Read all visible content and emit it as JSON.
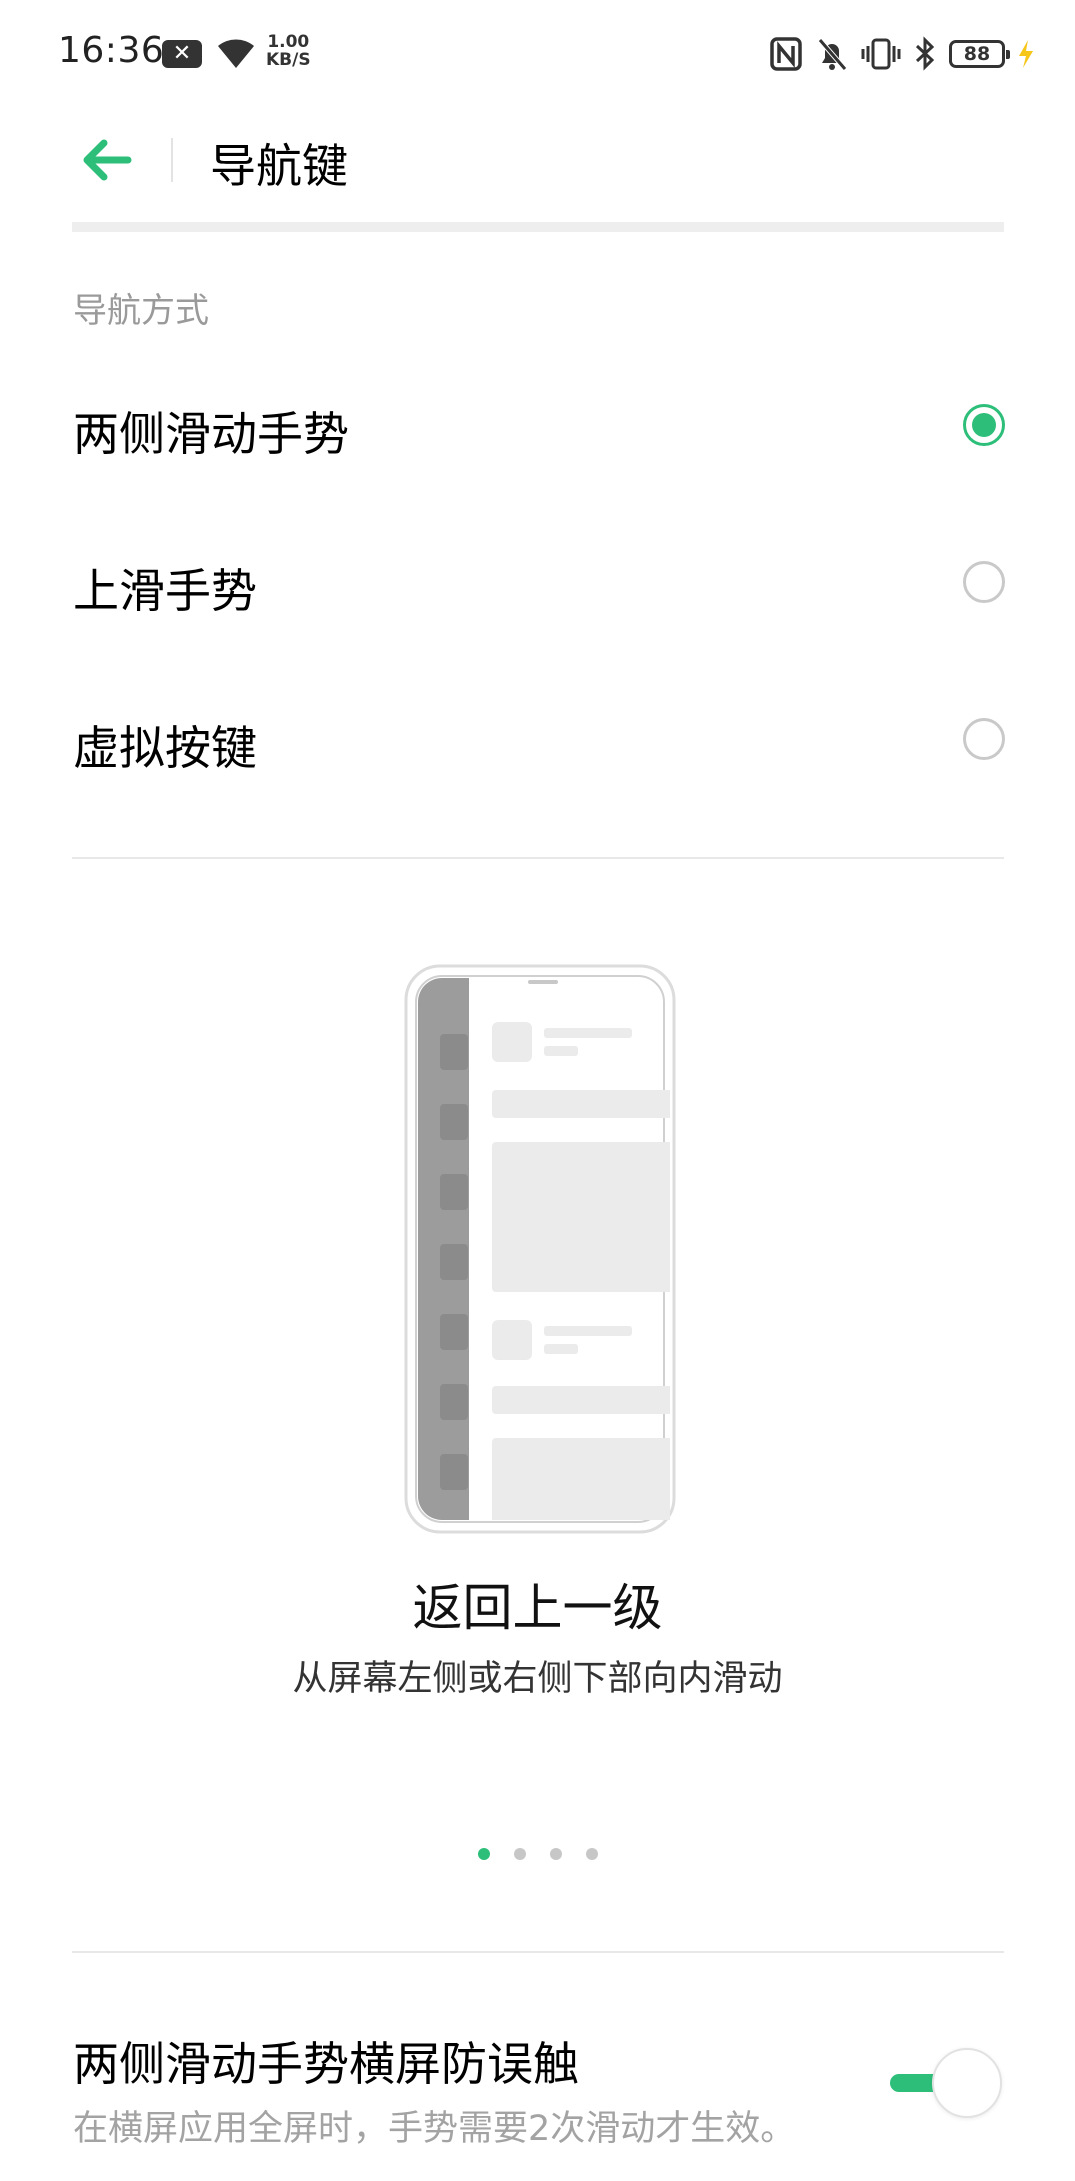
{
  "status_bar": {
    "time": "16:36",
    "net_speed_value": "1.00",
    "net_speed_unit": "KB/S",
    "battery": "88"
  },
  "header": {
    "title": "导航键"
  },
  "section": {
    "title": "导航方式",
    "options": [
      {
        "label": "两侧滑动手势",
        "selected": true
      },
      {
        "label": "上滑手势",
        "selected": false
      },
      {
        "label": "虚拟按键",
        "selected": false
      }
    ]
  },
  "illustration": {
    "title": "返回上一级",
    "description": "从屏幕左侧或右侧下部向内滑动",
    "page_count": 4,
    "active_page": 1
  },
  "landscape_protection": {
    "title": "两侧滑动手势横屏防误触",
    "description": "在横屏应用全屏时，手势需要2次滑动才生效。",
    "enabled": true
  },
  "colors": {
    "accent": "#2dbf7a",
    "secondary_text": "#9a9a9a",
    "divider": "#e8e8e8"
  }
}
